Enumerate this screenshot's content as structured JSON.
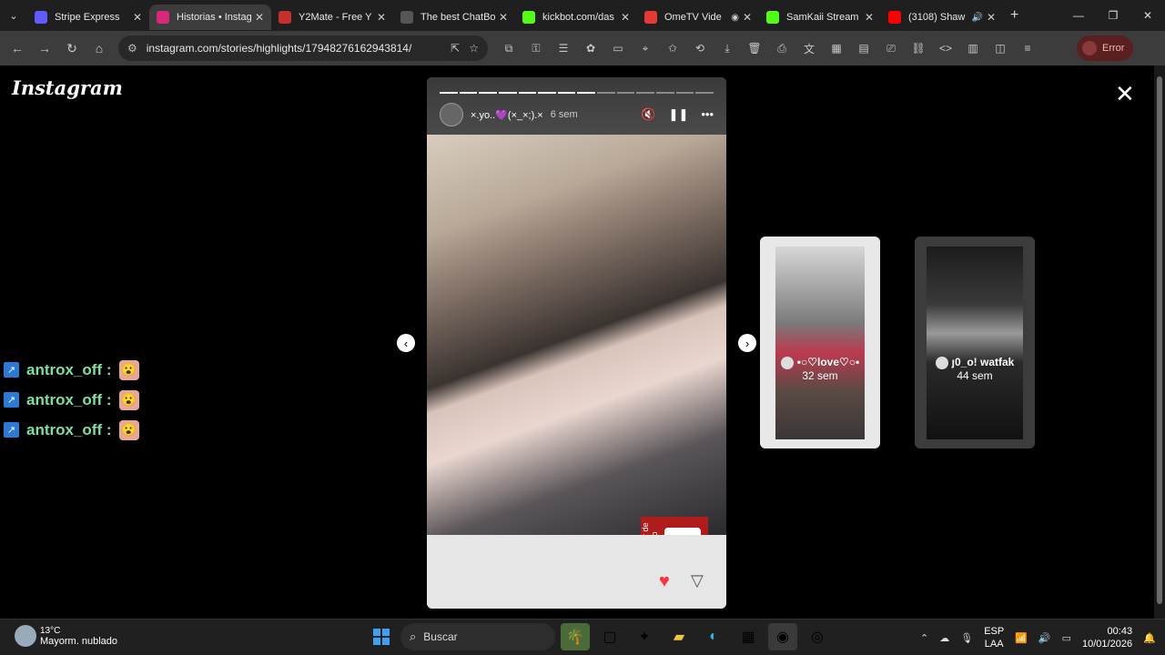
{
  "browser": {
    "tabs": [
      {
        "title": "Stripe Express",
        "icon": "stripe-icon",
        "color": "#635bff"
      },
      {
        "title": "Historias • Instag",
        "icon": "instagram-icon",
        "color": "#d62976",
        "active": true
      },
      {
        "title": "Y2Mate - Free Y",
        "icon": "y2mate-icon",
        "color": "#c4302b"
      },
      {
        "title": "The best ChatBo",
        "icon": "chatbot-icon",
        "color": "#555555"
      },
      {
        "title": "kickbot.com/das",
        "icon": "kickbot-icon",
        "color": "#53fc18"
      },
      {
        "title": "OmeTV Vide",
        "icon": "ometv-icon",
        "color": "#e53935"
      },
      {
        "title": "SamKaii Stream",
        "icon": "kick-icon",
        "color": "#53fc18"
      },
      {
        "title": "(3108) Shaw",
        "icon": "youtube-icon",
        "color": "#ff0000"
      }
    ],
    "address": "instagram.com/stories/highlights/17948276162943814/",
    "error_label": "Error"
  },
  "page": {
    "logo": "Instagram",
    "chat": [
      {
        "user": "antrox_off",
        "sep": ":"
      },
      {
        "user": "antrox_off",
        "sep": ":"
      },
      {
        "user": "antrox_off",
        "sep": ":"
      }
    ],
    "story": {
      "username": "×.yo..💜(×_×;).×",
      "time": "6 sem",
      "segments_total": 14,
      "segments_done": 8,
      "sticker_text": "simulador de autismo"
    },
    "previews": [
      {
        "name": "•○♡love♡○•",
        "ago": "32 sem"
      },
      {
        "name": "ȷ0_o!",
        "name_extra": "watfak",
        "ago": "44 sem"
      }
    ]
  },
  "taskbar": {
    "temp": "13°C",
    "weather": "Mayorm. nublado",
    "search_placeholder": "Buscar",
    "lang_top": "ESP",
    "lang_bottom": "LAA",
    "time": "00:43",
    "date": "10/01/2026"
  }
}
